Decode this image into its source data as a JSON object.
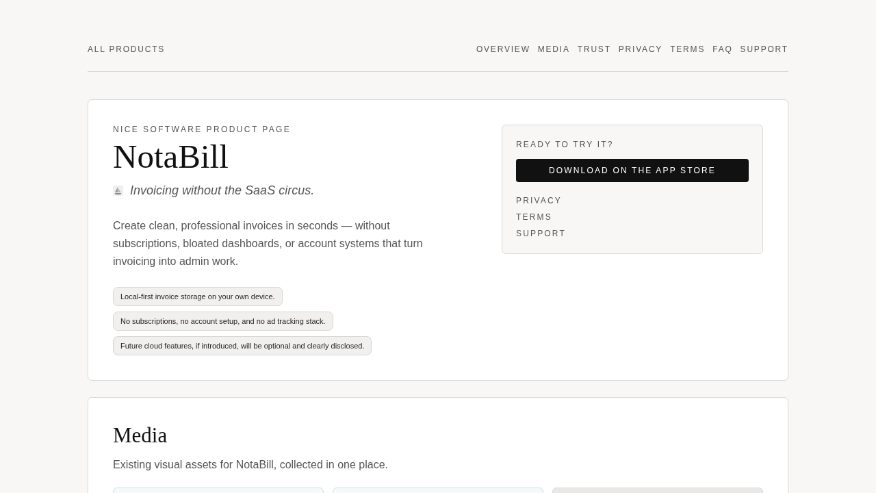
{
  "header": {
    "brand": "ALL PRODUCTS",
    "nav": [
      "OVERVIEW",
      "MEDIA",
      "TRUST",
      "PRIVACY",
      "TERMS",
      "FAQ",
      "SUPPORT"
    ]
  },
  "hero": {
    "eyebrow": "NICE SOFTWARE PRODUCT PAGE",
    "title": "NotaBill",
    "tagline": "Invoicing without the SaaS circus.",
    "description": "Create clean, professional invoices in seconds — without subscriptions, bloated dashboards, or account systems that turn invoicing into admin work.",
    "highlights": [
      "Local-first invoice storage on your own device.",
      "No subscriptions, no account setup, and no ad tracking stack.",
      "Future cloud features, if introduced, will be optional and clearly disclosed."
    ],
    "cta_panel": {
      "heading": "READY TO TRY IT?",
      "button": "DOWNLOAD ON THE APP STORE",
      "links": [
        "PRIVACY",
        "TERMS",
        "SUPPORT"
      ]
    }
  },
  "media": {
    "title": "Media",
    "description": "Existing visual assets for NotaBill, collected in one place.",
    "items": [
      {
        "kind": "screenshot"
      },
      {
        "kind": "screenshot"
      },
      {
        "kind": "image"
      }
    ]
  }
}
